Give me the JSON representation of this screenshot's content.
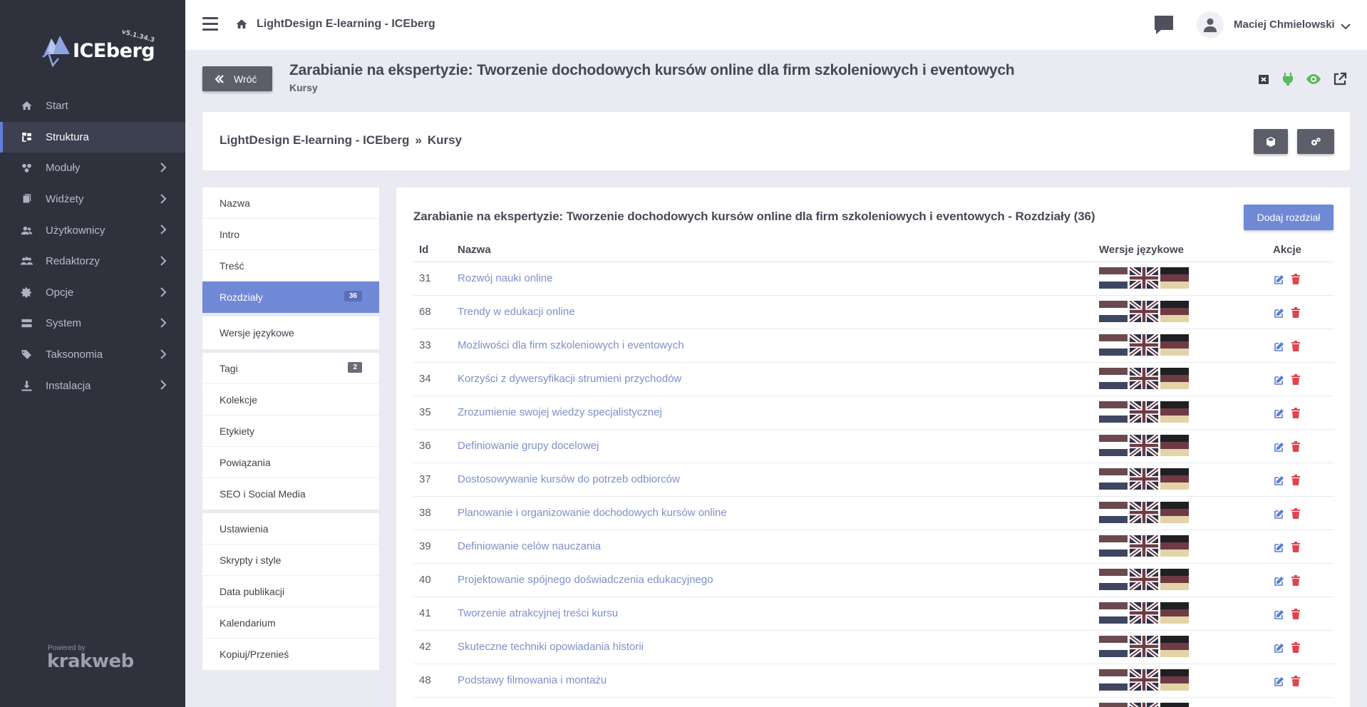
{
  "app": {
    "logo_text": "ICEberg",
    "version": "v5.1.34.3",
    "site_title": "LightDesign E-learning - ICEberg",
    "user_name": "Maciej Chmielowski"
  },
  "sidebar": {
    "items": [
      {
        "label": "Start",
        "icon": "home-icon",
        "has_children": false,
        "active": false
      },
      {
        "label": "Struktura",
        "icon": "structure-icon",
        "has_children": false,
        "active": true
      },
      {
        "label": "Moduły",
        "icon": "modules-icon",
        "has_children": true,
        "active": false
      },
      {
        "label": "Widżety",
        "icon": "widgets-icon",
        "has_children": true,
        "active": false
      },
      {
        "label": "Użytkownicy",
        "icon": "users-icon",
        "has_children": true,
        "active": false
      },
      {
        "label": "Redaktorzy",
        "icon": "editors-icon",
        "has_children": true,
        "active": false
      },
      {
        "label": "Opcje",
        "icon": "gear-icon",
        "has_children": true,
        "active": false
      },
      {
        "label": "System",
        "icon": "server-icon",
        "has_children": true,
        "active": false
      },
      {
        "label": "Taksonomia",
        "icon": "tags-icon",
        "has_children": true,
        "active": false
      },
      {
        "label": "Instalacja",
        "icon": "download-icon",
        "has_children": true,
        "active": false
      }
    ],
    "powered_by": "Powered by",
    "powered_brand": "krakweb"
  },
  "header": {
    "back_label": "Wróć",
    "title": "Zarabianie na ekspertyzie: Tworzenie dochodowych kursów online dla firm szkoleniowych i eventowych",
    "subtitle": "Kursy",
    "icons": [
      "close-box-icon",
      "plug-icon",
      "eye-icon",
      "external-link-icon"
    ]
  },
  "breadcrumb": {
    "root": "LightDesign E-learning - ICEberg",
    "separator": "»",
    "current": "Kursy"
  },
  "left_menu": {
    "groups": [
      [
        {
          "label": "Nazwa"
        },
        {
          "label": "Intro"
        },
        {
          "label": "Treść"
        },
        {
          "label": "Rozdziały",
          "badge": "36",
          "active": true
        }
      ],
      [
        {
          "label": "Wersje językowe"
        }
      ],
      [
        {
          "label": "Tagi",
          "badge": "2"
        },
        {
          "label": "Kolekcje"
        },
        {
          "label": "Etykiety"
        },
        {
          "label": "Powiązania"
        },
        {
          "label": "SEO i Social Media"
        }
      ],
      [
        {
          "label": "Ustawienia"
        },
        {
          "label": "Skrypty i style"
        },
        {
          "label": "Data publikacji"
        },
        {
          "label": "Kalendarium"
        },
        {
          "label": "Kopiuj/Przenieś"
        }
      ]
    ]
  },
  "main": {
    "card_title": "Zarabianie na ekspertyzie: Tworzenie dochodowych kursów online dla firm szkoleniowych i eventowych - Rozdziały (36)",
    "add_button": "Dodaj rozdział",
    "columns": {
      "id": "Id",
      "name": "Nazwa",
      "langs": "Wersje językowe",
      "actions": "Akcje"
    },
    "rows": [
      {
        "id": "31",
        "name": "Rozwój nauki online"
      },
      {
        "id": "68",
        "name": "Trendy w edukacji online"
      },
      {
        "id": "33",
        "name": "Możliwości dla firm szkoleniowych i eventowych"
      },
      {
        "id": "34",
        "name": "Korzyści z dywersyfikacji strumieni przychodów"
      },
      {
        "id": "35",
        "name": "Zrozumienie swojej wiedzy specjalistycznej"
      },
      {
        "id": "36",
        "name": "Definiowanie grupy docelowej"
      },
      {
        "id": "37",
        "name": "Dostosowywanie kursów do potrzeb odbiorców"
      },
      {
        "id": "38",
        "name": "Planowanie i organizowanie dochodowych kursów online"
      },
      {
        "id": "39",
        "name": "Definiowanie celów nauczania"
      },
      {
        "id": "40",
        "name": "Projektowanie spójnego doświadczenia edukacyjnego"
      },
      {
        "id": "41",
        "name": "Tworzenie atrakcyjnej treści kursu"
      },
      {
        "id": "42",
        "name": "Skuteczne techniki opowiadania historii"
      },
      {
        "id": "48",
        "name": "Podstawy filmowania i montażu"
      },
      {
        "id": "",
        "name": ""
      }
    ],
    "lang_flags": [
      "pl-flag",
      "gb-flag",
      "de-flag"
    ]
  },
  "colors": {
    "sidebar_bg": "#2f313d",
    "accent": "#7089d6",
    "link": "#7d90c9",
    "delete": "#e0444f",
    "success": "#5cb85c"
  }
}
